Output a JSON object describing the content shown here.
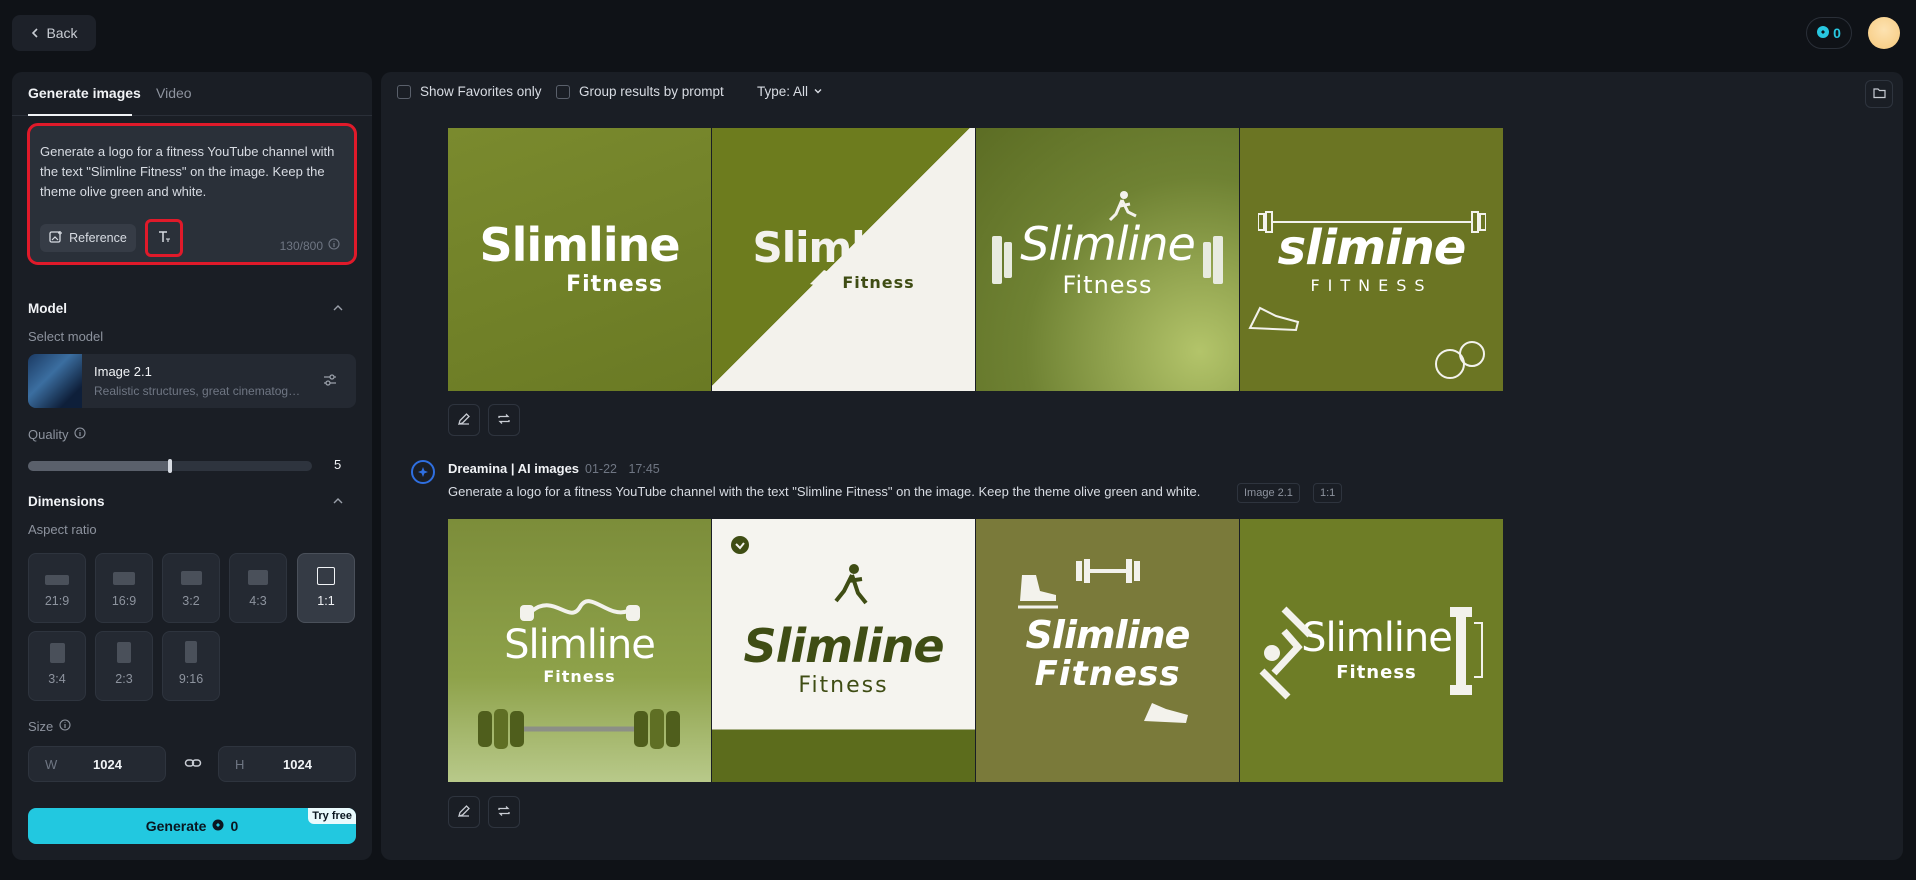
{
  "header": {
    "back_label": "Back",
    "credits": "0"
  },
  "tabs": [
    {
      "label": "Generate images"
    },
    {
      "label": "Video"
    }
  ],
  "prompt": {
    "text": "Generate a logo for a fitness YouTube channel with the text \"Slimline Fitness\" on the image. Keep the theme olive green and white.",
    "reference_label": "Reference",
    "counter": "130/800"
  },
  "model": {
    "section_title": "Model",
    "select_label": "Select model",
    "name": "Image 2.1",
    "description": "Realistic structures, great cinematography"
  },
  "quality": {
    "label": "Quality",
    "value": "5",
    "fraction": 0.5
  },
  "dimensions": {
    "section_title": "Dimensions",
    "aspect_label": "Aspect ratio",
    "ratios": [
      "21:9",
      "16:9",
      "3:2",
      "4:3",
      "1:1",
      "3:4",
      "2:3",
      "9:16"
    ],
    "selected": "1:1",
    "size_label": "Size",
    "width_label": "W",
    "width": "1024",
    "height_label": "H",
    "height": "1024"
  },
  "generate": {
    "label": "Generate",
    "cost": "0",
    "badge": "Try free"
  },
  "filters": {
    "favorites": "Show Favorites only",
    "group": "Group results by prompt",
    "type": "Type: All"
  },
  "batch1": {
    "images": [
      {
        "title": "Slimline",
        "subtitle": "Fitness"
      },
      {
        "title": "Slimline",
        "subtitle": "Fitness"
      },
      {
        "title": "Slimline",
        "subtitle": "Fitness"
      },
      {
        "title": "slimine",
        "subtitle": "FITNESS"
      }
    ]
  },
  "batch2": {
    "author": "Dreamina | AI images",
    "timestamp": "01-22 17:45",
    "prompt": "Generate a logo for a fitness YouTube channel with the text \"Slimline Fitness\" on the image. Keep the theme olive green and white.",
    "model_chip": "Image 2.1",
    "ratio_chip": "1:1",
    "images": [
      {
        "title": "Slimline",
        "subtitle": "Fitness"
      },
      {
        "title": "Slimline",
        "subtitle": "Fitness"
      },
      {
        "title": "Slimline",
        "subtitle": "Fitness"
      },
      {
        "title": "Slimline",
        "subtitle": "Fitness"
      }
    ]
  },
  "colors": {
    "accent": "#22c8e0",
    "highlight": "#e01a2a",
    "olive": "#6b7a22"
  }
}
